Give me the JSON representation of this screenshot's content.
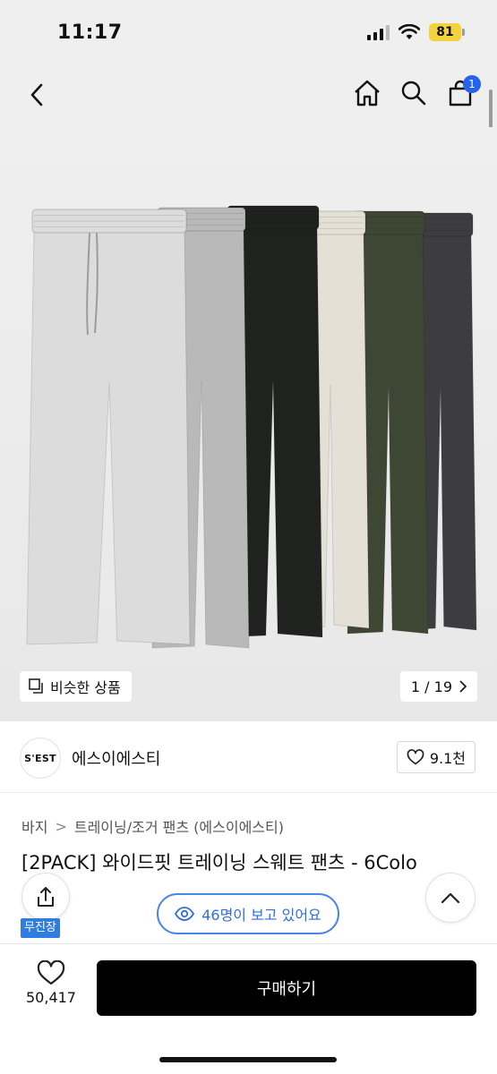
{
  "status_bar": {
    "time": "11:17",
    "battery": "81",
    "icons": [
      "signal-icon",
      "wifi-icon",
      "battery-icon"
    ]
  },
  "nav": {
    "icons": [
      "back-icon",
      "home-icon",
      "search-icon",
      "cart-icon"
    ],
    "cart_badge": "1",
    "badge_color": "#2563eb"
  },
  "product_image": {
    "pants_colors": [
      "#dcdcdc",
      "#b9b9b9",
      "#1f221f",
      "#e4e0d6",
      "#3e4634",
      "#3d3d3f"
    ],
    "similar_label": "비슷한 상품",
    "pager": "1 / 19"
  },
  "brand": {
    "logo_text": "S'EST",
    "name": "에스이에스티",
    "likes": "9.1천"
  },
  "breadcrumb": {
    "items": [
      "바지",
      "트레이닝/조거 팬츠 (에스이에스티)"
    ],
    "separator": ">"
  },
  "product": {
    "title": "[2PACK] 와이드핏 트레이닝 스웨트 팬츠 - 6Colo"
  },
  "floating": {
    "free_shipping": "무진장",
    "viewers": "46명이 보고 있어요",
    "accent": "#2f6fd8"
  },
  "bottom_bar": {
    "wish_count": "50,417",
    "buy_label": "구매하기"
  }
}
